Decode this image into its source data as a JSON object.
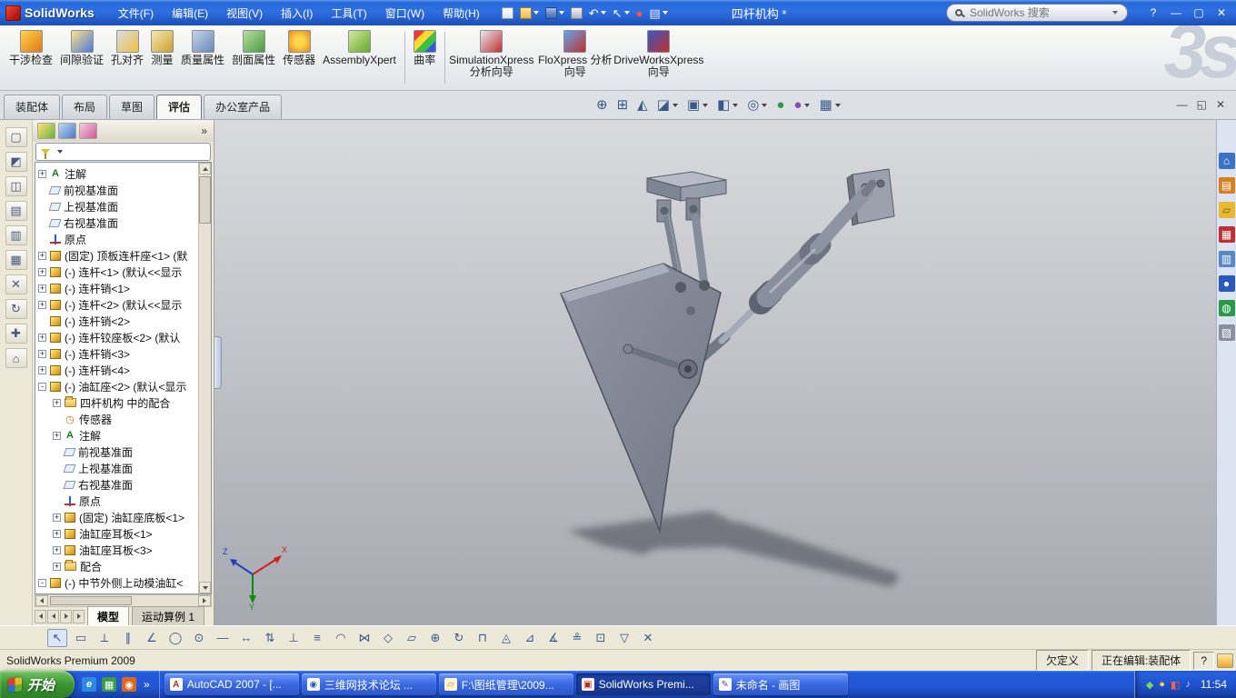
{
  "title_bar": {
    "app_name": "SolidWorks",
    "menus": [
      "文件(F)",
      "编辑(E)",
      "视图(V)",
      "插入(I)",
      "工具(T)",
      "窗口(W)",
      "帮助(H)"
    ],
    "document_title": "四杆机构 *",
    "search_placeholder": "SolidWorks 搜索",
    "controls": [
      "?",
      "—",
      "▢",
      "✕"
    ]
  },
  "quick_tools": [
    {
      "name": "new-document",
      "glyph": ""
    },
    {
      "name": "open-document",
      "glyph": ""
    },
    {
      "name": "save-document",
      "glyph": ""
    },
    {
      "name": "print-document",
      "glyph": ""
    },
    {
      "name": "undo",
      "glyph": "↶"
    },
    {
      "name": "select-cursor",
      "glyph": "↖"
    },
    {
      "name": "rebuild",
      "glyph": "●"
    },
    {
      "name": "options",
      "glyph": "▤"
    }
  ],
  "command_manager": {
    "watermark": "3s",
    "tools": [
      {
        "label": "干涉检查"
      },
      {
        "label": "间隙验证"
      },
      {
        "label": "孔对齐"
      },
      {
        "label": "测量"
      },
      {
        "label": "质量属性"
      },
      {
        "label": "剖面属性"
      },
      {
        "label": "传感器"
      },
      {
        "label": "AssemblyXpert"
      },
      {
        "label": "曲率"
      },
      {
        "label": "SimulationXpress 分析向导"
      },
      {
        "label": "FloXpress 分析向导"
      },
      {
        "label": "DriveWorksXpress 向导"
      }
    ]
  },
  "ribbon_tabs": {
    "tabs": [
      {
        "label": "装配体"
      },
      {
        "label": "布局"
      },
      {
        "label": "草图"
      },
      {
        "label": "评估"
      },
      {
        "label": "办公室产品"
      }
    ]
  },
  "heads_up": {
    "tools": [
      {
        "name": "zoom-fit",
        "glyph": "⊕"
      },
      {
        "name": "zoom-to-area",
        "glyph": "⊞"
      },
      {
        "name": "magnified-selection",
        "glyph": "◭"
      },
      {
        "name": "section-view",
        "glyph": "◪"
      },
      {
        "name": "view-orientation",
        "glyph": "▣"
      },
      {
        "name": "display-style",
        "glyph": "◧"
      },
      {
        "name": "hide-show-items",
        "glyph": "◎"
      },
      {
        "name": "edit-appearance",
        "glyph": "●"
      },
      {
        "name": "apply-scene",
        "glyph": "●"
      },
      {
        "name": "view-settings",
        "glyph": "▦"
      }
    ]
  },
  "doc_window_controls": [
    "—",
    "◱",
    "✕"
  ],
  "left_toolbar": {
    "tools": [
      {
        "glyph": "▢"
      },
      {
        "glyph": "◩"
      },
      {
        "glyph": "◫"
      },
      {
        "glyph": "▤"
      },
      {
        "glyph": "▥"
      },
      {
        "glyph": "▦"
      },
      {
        "glyph": "✕"
      },
      {
        "glyph": "↻"
      },
      {
        "glyph": "✚"
      },
      {
        "glyph": "⌂"
      }
    ]
  },
  "feature_tree": {
    "overflow_glyph": "»",
    "icon_glyphs": {
      "annotation": "A",
      "sensor": "◷"
    },
    "items": [
      {
        "exp": "+",
        "label": "注解"
      },
      {
        "exp": "",
        "label": "前视基准面"
      },
      {
        "exp": "",
        "label": "上视基准面"
      },
      {
        "exp": "",
        "label": "右视基准面"
      },
      {
        "exp": "",
        "label": "原点"
      },
      {
        "exp": "+",
        "label": "(固定) 顶板连杆座<1> (默"
      },
      {
        "exp": "+",
        "label": "(-) 连杆<1> (默认<<显示"
      },
      {
        "exp": "+",
        "label": "(-) 连杆销<1>"
      },
      {
        "exp": "+",
        "label": "(-) 连杆<2> (默认<<显示"
      },
      {
        "exp": "+",
        "label": "(-) 连杆销<2>"
      },
      {
        "exp": "+",
        "label": "(-) 连杆铰座板<2> (默认"
      },
      {
        "exp": "+",
        "label": "(-) 连杆销<3>"
      },
      {
        "exp": "+",
        "label": "(-) 连杆销<4>"
      },
      {
        "exp": "-",
        "label": "(-) 油缸座<2> (默认<显示"
      },
      {
        "exp": "+",
        "label": "四杆机构 中的配合"
      },
      {
        "exp": "",
        "label": "传感器"
      },
      {
        "exp": "+",
        "label": "注解"
      },
      {
        "exp": "",
        "label": "前视基准面"
      },
      {
        "exp": "",
        "label": "上视基准面"
      },
      {
        "exp": "",
        "label": "右视基准面"
      },
      {
        "exp": "",
        "label": "原点"
      },
      {
        "exp": "+",
        "label": "(固定) 油缸座底板<1>"
      },
      {
        "exp": "+",
        "label": "油缸座耳板<1>"
      },
      {
        "exp": "+",
        "label": "油缸座耳板<3>"
      },
      {
        "exp": "+",
        "label": "配合"
      },
      {
        "exp": "-",
        "label": "(-) 中节外侧上动模油缸<"
      }
    ]
  },
  "model_tabs": {
    "tabs": [
      {
        "label": "模型"
      },
      {
        "label": "运动算例 1"
      }
    ]
  },
  "viewport": {
    "triad": {
      "x": "X",
      "y": "Y",
      "z": "Z"
    }
  },
  "task_pane": {
    "tools": [
      {
        "name": "solidworks-resources",
        "glyph": "⌂"
      },
      {
        "name": "design-library",
        "glyph": "▤"
      },
      {
        "name": "file-explorer",
        "glyph": "▱"
      },
      {
        "name": "toolbox",
        "glyph": "▦"
      },
      {
        "name": "view-palette",
        "glyph": "▥"
      },
      {
        "name": "appearances",
        "glyph": "●"
      },
      {
        "name": "scenes",
        "glyph": "◍"
      },
      {
        "name": "custom-properties",
        "glyph": "▧"
      }
    ]
  },
  "bottom_toolbar": {
    "tools": [
      {
        "glyph": "↖"
      },
      {
        "glyph": "▭"
      },
      {
        "glyph": "⟂"
      },
      {
        "glyph": "∥"
      },
      {
        "glyph": "∠"
      },
      {
        "glyph": "◯"
      },
      {
        "glyph": "⊙"
      },
      {
        "glyph": "—"
      },
      {
        "glyph": "↔"
      },
      {
        "glyph": "⇅"
      },
      {
        "glyph": "⊥"
      },
      {
        "glyph": "≡"
      },
      {
        "glyph": "◠"
      },
      {
        "glyph": "⋈"
      },
      {
        "glyph": "◇"
      },
      {
        "glyph": "▱"
      },
      {
        "glyph": "⊕"
      },
      {
        "glyph": "↻"
      },
      {
        "glyph": "⊓"
      },
      {
        "glyph": "◬"
      },
      {
        "glyph": "⊿"
      },
      {
        "glyph": "∡"
      },
      {
        "glyph": "≗"
      },
      {
        "glyph": "⊡"
      },
      {
        "glyph": "▽"
      },
      {
        "glyph": "✕"
      }
    ]
  },
  "status_bar": {
    "left": "SolidWorks Premium 2009",
    "state": "欠定义",
    "editing": "正在编辑:装配体",
    "help": "?"
  },
  "taskbar": {
    "start_label": "开始",
    "quick_launch": [
      {
        "glyph": "e"
      },
      {
        "glyph": "▦"
      },
      {
        "glyph": "◉"
      }
    ],
    "chevron": "»",
    "tasks": [
      {
        "label": "AutoCAD 2007 - [...",
        "icon": "A"
      },
      {
        "label": "三维网技术论坛 ...",
        "icon": "◉"
      },
      {
        "label": "F:\\图纸管理\\2009...",
        "icon": "▱"
      },
      {
        "label": "SolidWorks Premi...",
        "icon": "▣"
      },
      {
        "label": "未命名 - 画图",
        "icon": "✎"
      }
    ],
    "tray_icons": [
      {
        "glyph": "◆"
      },
      {
        "glyph": "●"
      },
      {
        "glyph": "◧"
      },
      {
        "glyph": "♪"
      }
    ],
    "time": "11:54"
  }
}
